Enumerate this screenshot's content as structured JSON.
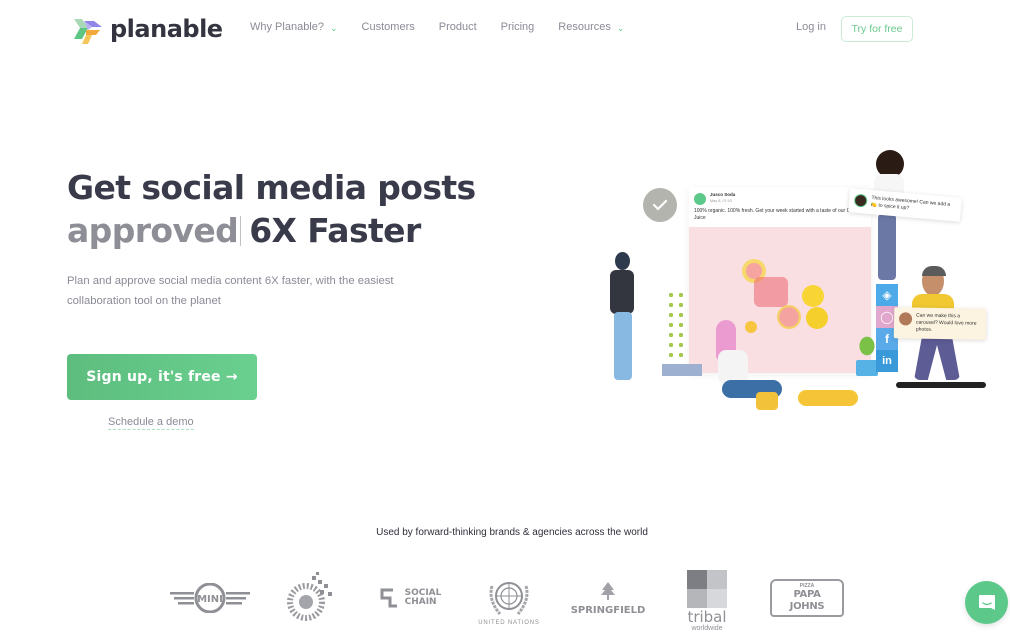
{
  "nav": {
    "brand": "planable",
    "menu": [
      {
        "label": "Why Planable?",
        "has_dropdown": true
      },
      {
        "label": "Customers",
        "has_dropdown": false
      },
      {
        "label": "Product",
        "has_dropdown": false
      },
      {
        "label": "Pricing",
        "has_dropdown": false
      },
      {
        "label": "Resources",
        "has_dropdown": true
      }
    ],
    "login_label": "Log in",
    "cta_label": "Try for free"
  },
  "hero": {
    "title_line1": "Get social media posts",
    "title_rotating_word": "approved",
    "title_line2_rest": "6X Faster",
    "subtitle": "Plan and approve social media content 6X faster, with the easiest collaboration tool on the planet",
    "signup_label": "Sign up, it's free →",
    "demo_label": "Schedule a demo"
  },
  "illustration": {
    "post": {
      "account_name": "Jusco Soda",
      "date": "May 8, 07:03",
      "text": "100% organic. 100% fresh. Get your week started with a taste of our Citrus Juice"
    },
    "comments": [
      {
        "text": "This looks awesome! Can we add a 🍋 to spice it up?"
      },
      {
        "text": "Can we make this a carousel? Would love more photos."
      }
    ],
    "social_icons": [
      "twitter-icon",
      "instagram-icon",
      "facebook-icon",
      "linkedin-icon"
    ]
  },
  "brands": {
    "caption": "Used by forward-thinking brands & agencies across the world",
    "logos": [
      {
        "name": "MINI",
        "label": "MINI"
      },
      {
        "name": "Publicis",
        "label": ""
      },
      {
        "name": "Social Chain",
        "label": "SOCIAL\nCHAIN"
      },
      {
        "name": "United Nations",
        "label": "UNITED NATIONS"
      },
      {
        "name": "Springfield",
        "label": "SPRINGFIELD"
      },
      {
        "name": "Tribal Worldwide",
        "label": "tribal",
        "sublabel": "worldwide"
      },
      {
        "name": "Papa John's",
        "label": "PAPA JOHNS",
        "toplabel": "PIZZA"
      }
    ]
  },
  "colors": {
    "accent_green": "#5cc98a",
    "heading": "#3a3b4a",
    "muted": "#8a8b96"
  }
}
